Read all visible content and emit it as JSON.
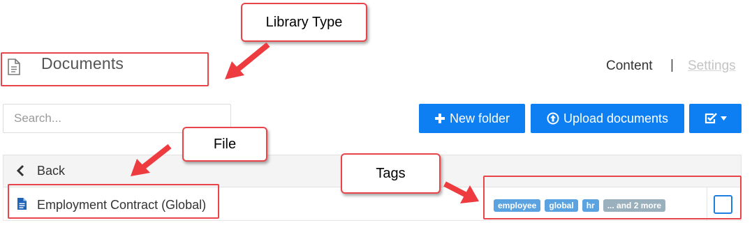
{
  "header": {
    "title": "Documents",
    "title_icon": "document-icon",
    "nav": {
      "content": "Content",
      "separator": "|",
      "settings": "Settings"
    }
  },
  "search": {
    "placeholder": "Search...",
    "value": ""
  },
  "toolbar": {
    "new_folder": "New folder",
    "upload": "Upload documents",
    "check_menu_icon": "check-square-icon"
  },
  "list": {
    "back_label": "Back",
    "rows": [
      {
        "name": "Employment Contract (Global)",
        "icon": "file-text-icon",
        "tags": [
          "employee",
          "global",
          "hr"
        ],
        "more_tags": "... and 2 more"
      }
    ]
  },
  "annotations": {
    "library_type": "Library Type",
    "file": "File",
    "tags": "Tags",
    "color": "#e8454a"
  }
}
